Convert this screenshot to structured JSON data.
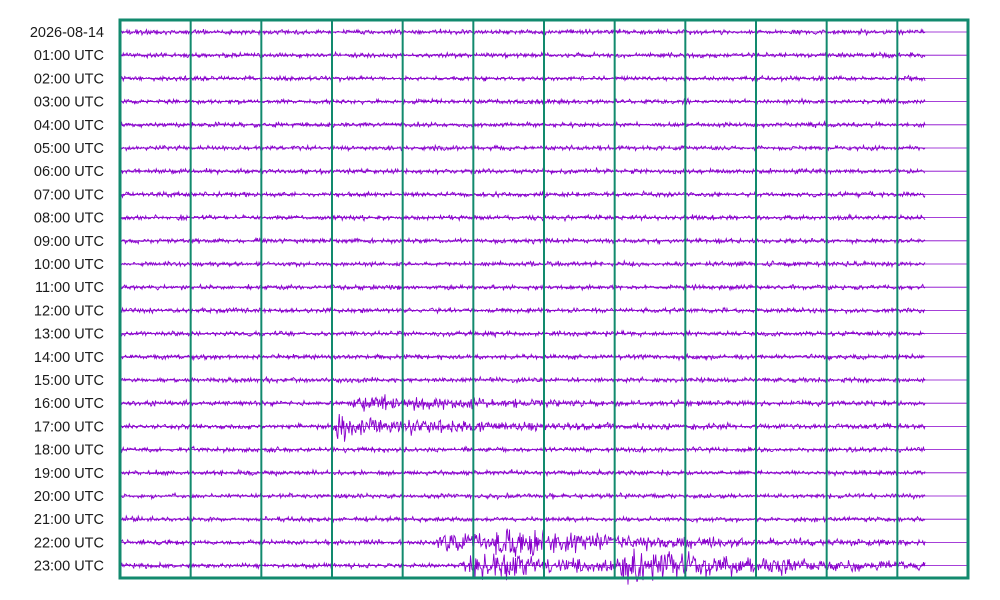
{
  "chart_data": {
    "type": "helicorder",
    "row_labels": [
      "2026-08-14",
      "01:00 UTC",
      "02:00 UTC",
      "03:00 UTC",
      "04:00 UTC",
      "05:00 UTC",
      "06:00 UTC",
      "07:00 UTC",
      "08:00 UTC",
      "09:00 UTC",
      "10:00 UTC",
      "11:00 UTC",
      "12:00 UTC",
      "13:00 UTC",
      "14:00 UTC",
      "15:00 UTC",
      "16:00 UTC",
      "17:00 UTC",
      "18:00 UTC",
      "19:00 UTC",
      "20:00 UTC",
      "21:00 UTC",
      "22:00 UTC",
      "23:00 UTC"
    ],
    "minutes_per_row": 60,
    "minute_divisions": 12,
    "recorded_fraction_of_last_row": 0.95,
    "events": [
      {
        "row": "16:00 UTC",
        "minute": 17.2,
        "relative_amplitude": 2.0
      },
      {
        "row": "17:00 UTC",
        "minute": 15.6,
        "relative_amplitude": 3.2
      },
      {
        "row": "22:00 UTC",
        "minute": 23.0,
        "relative_amplitude": 2.4
      },
      {
        "row": "22:00 UTC",
        "minute": 27.0,
        "relative_amplitude": 3.4
      },
      {
        "row": "23:00 UTC",
        "minute": 25.0,
        "relative_amplitude": 4.2
      },
      {
        "row": "23:00 UTC",
        "minute": 36.0,
        "relative_amplitude": 4.5
      }
    ],
    "colors": {
      "trace": "#8800cc",
      "grid": "#128a6e",
      "baseline": "#8800cc",
      "label": "#1a1a1a"
    },
    "grid": true,
    "legend": "none"
  }
}
